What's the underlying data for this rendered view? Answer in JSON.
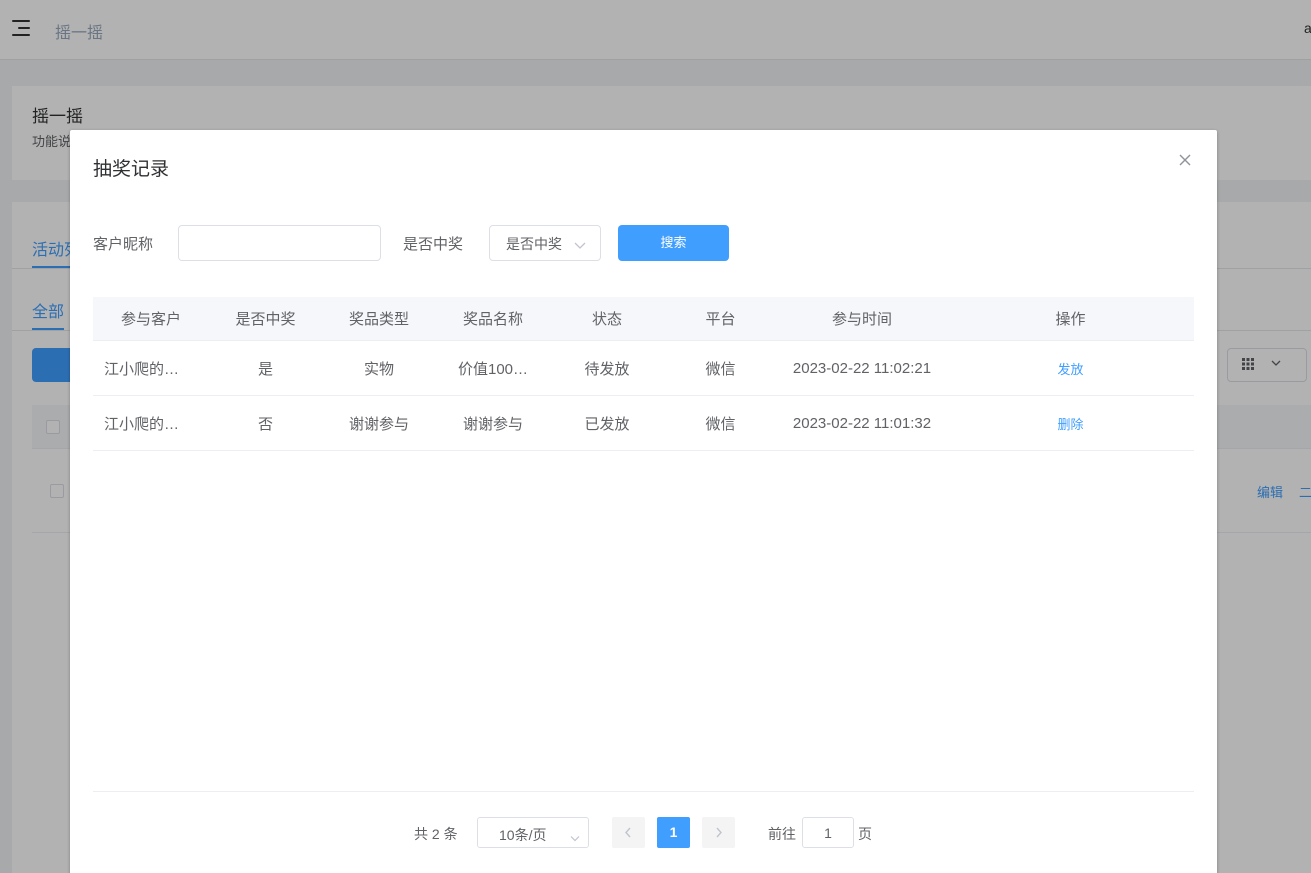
{
  "background": {
    "breadcrumb": "摇一摇",
    "user_initial": "a",
    "card_title": "摇一摇",
    "card_desc": "功能说",
    "tab_activity": "活动列",
    "tab_all": "全部",
    "row_actions": [
      "编辑",
      "二"
    ]
  },
  "dialog": {
    "title": "抽奖记录",
    "filters": {
      "nickname_label": "客户昵称",
      "nickname_value": "",
      "win_label": "是否中奖",
      "win_select_value": "是否中奖",
      "search_button": "搜索"
    },
    "table": {
      "headers": [
        "参与客户",
        "是否中奖",
        "奖品类型",
        "奖品名称",
        "状态",
        "平台",
        "参与时间",
        "操作"
      ],
      "rows": [
        {
          "customer": "江小爬的…",
          "win": "是",
          "prize_type": "实物",
          "prize_name": "价值100…",
          "status": "待发放",
          "platform": "微信",
          "time": "2023-02-22 11:02:21",
          "action": "发放"
        },
        {
          "customer": "江小爬的…",
          "win": "否",
          "prize_type": "谢谢参与",
          "prize_name": "谢谢参与",
          "status": "已发放",
          "platform": "微信",
          "time": "2023-02-22 11:01:32",
          "action": "删除"
        }
      ]
    },
    "pagination": {
      "total_text": "共 2 条",
      "page_size": "10条/页",
      "current_page": "1",
      "goto_label": "前往",
      "goto_value": "1",
      "page_suffix": "页"
    }
  },
  "colors": {
    "primary": "#409eff",
    "overlay": "rgba(0,0,0,0.3)",
    "header_bg": "#f5f7fa"
  }
}
